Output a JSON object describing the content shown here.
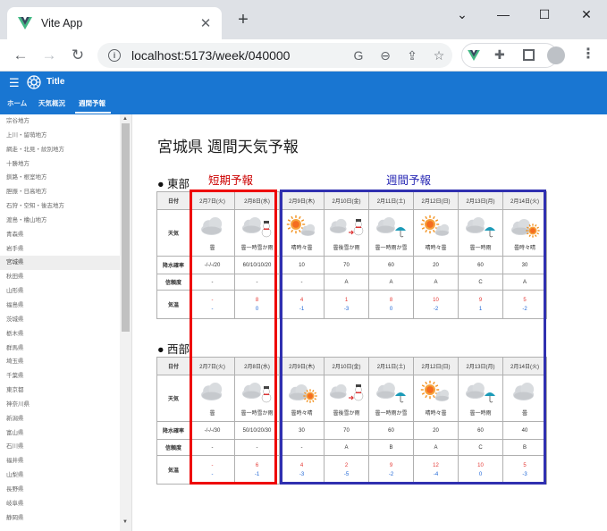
{
  "browser": {
    "tab_title": "Vite App",
    "url": "localhost:5173/week/040000"
  },
  "app": {
    "title": "Title",
    "nav_tabs": [
      {
        "label": "ホーム"
      },
      {
        "label": "天気概況"
      },
      {
        "label": "週間予報"
      }
    ],
    "active_tab": "週間予報"
  },
  "sidebar": {
    "items": [
      "宗谷地方",
      "上川・留萌地方",
      "網走・北見・紋別地方",
      "十勝地方",
      "釧路・根室地方",
      "胆振・日高地方",
      "石狩・空知・後志地方",
      "渡島・檜山地方",
      "青森県",
      "岩手県",
      "宮城県",
      "秋田県",
      "山形県",
      "福島県",
      "茨城県",
      "栃木県",
      "群馬県",
      "埼玉県",
      "千葉県",
      "東京都",
      "神奈川県",
      "新潟県",
      "富山県",
      "石川県",
      "福井県",
      "山梨県",
      "長野県",
      "岐阜県",
      "静岡県"
    ],
    "active": "宮城県"
  },
  "main": {
    "title": "宮城県 週間天気予報",
    "label_short": "短期予報",
    "label_week": "週間予報",
    "row_labels": {
      "date": "日付",
      "weather": "天気",
      "pop": "降水確率",
      "reliability": "信頼度",
      "temp": "気温"
    },
    "regions": [
      {
        "name": "東部",
        "days": [
          {
            "date": "2月7日(火)",
            "icon": "cloud-icon",
            "weather": "曇",
            "pop": "-/-/-/20",
            "rel": "-",
            "tmax": "-",
            "tmin": "-"
          },
          {
            "date": "2月8日(水)",
            "icon": "cloud-snow-icon",
            "weather": "曇一時雪か雨",
            "pop": "60/10/10/20",
            "rel": "-",
            "tmax": "8",
            "tmin": "0"
          },
          {
            "date": "2月9日(木)",
            "icon": "sun-cloud-icon",
            "weather": "晴時々曇",
            "pop": "10",
            "rel": "-",
            "tmax": "4",
            "tmin": "-1"
          },
          {
            "date": "2月10日(金)",
            "icon": "cloud-then-snow-icon",
            "weather": "曇後雪か雨",
            "pop": "70",
            "rel": "A",
            "tmax": "1",
            "tmin": "-3"
          },
          {
            "date": "2月11日(土)",
            "icon": "cloud-rain-icon",
            "weather": "曇一時雨か雪",
            "pop": "60",
            "rel": "A",
            "tmax": "8",
            "tmin": "0"
          },
          {
            "date": "2月12日(日)",
            "icon": "sun-cloud-icon",
            "weather": "晴時々曇",
            "pop": "20",
            "rel": "A",
            "tmax": "10",
            "tmin": "-2"
          },
          {
            "date": "2月13日(月)",
            "icon": "cloud-rain-icon",
            "weather": "曇一時雨",
            "pop": "60",
            "rel": "C",
            "tmax": "9",
            "tmin": "1"
          },
          {
            "date": "2月14日(火)",
            "icon": "cloud-sun-icon",
            "weather": "曇時々晴",
            "pop": "30",
            "rel": "A",
            "tmax": "5",
            "tmin": "-2"
          }
        ]
      },
      {
        "name": "西部",
        "days": [
          {
            "date": "2月7日(火)",
            "icon": "cloud-icon",
            "weather": "曇",
            "pop": "-/-/-/30",
            "rel": "-",
            "tmax": "-",
            "tmin": "-"
          },
          {
            "date": "2月8日(水)",
            "icon": "cloud-snow-icon",
            "weather": "曇一時雪か雨",
            "pop": "50/10/20/30",
            "rel": "-",
            "tmax": "6",
            "tmin": "-1"
          },
          {
            "date": "2月9日(木)",
            "icon": "cloud-sun-icon",
            "weather": "曇時々晴",
            "pop": "30",
            "rel": "-",
            "tmax": "4",
            "tmin": "-3"
          },
          {
            "date": "2月10日(金)",
            "icon": "cloud-then-snow-icon",
            "weather": "曇後雪か雨",
            "pop": "70",
            "rel": "A",
            "tmax": "2",
            "tmin": "-5"
          },
          {
            "date": "2月11日(土)",
            "icon": "cloud-rain-icon",
            "weather": "曇一時雨か雪",
            "pop": "60",
            "rel": "B",
            "tmax": "9",
            "tmin": "-2"
          },
          {
            "date": "2月12日(日)",
            "icon": "sun-cloud-icon",
            "weather": "晴時々曇",
            "pop": "20",
            "rel": "A",
            "tmax": "12",
            "tmin": "-4"
          },
          {
            "date": "2月13日(月)",
            "icon": "cloud-rain-icon",
            "weather": "曇一時雨",
            "pop": "60",
            "rel": "C",
            "tmax": "10",
            "tmin": "0"
          },
          {
            "date": "2月14日(火)",
            "icon": "cloud-icon",
            "weather": "曇",
            "pop": "40",
            "rel": "B",
            "tmax": "5",
            "tmin": "-3"
          }
        ]
      }
    ]
  }
}
